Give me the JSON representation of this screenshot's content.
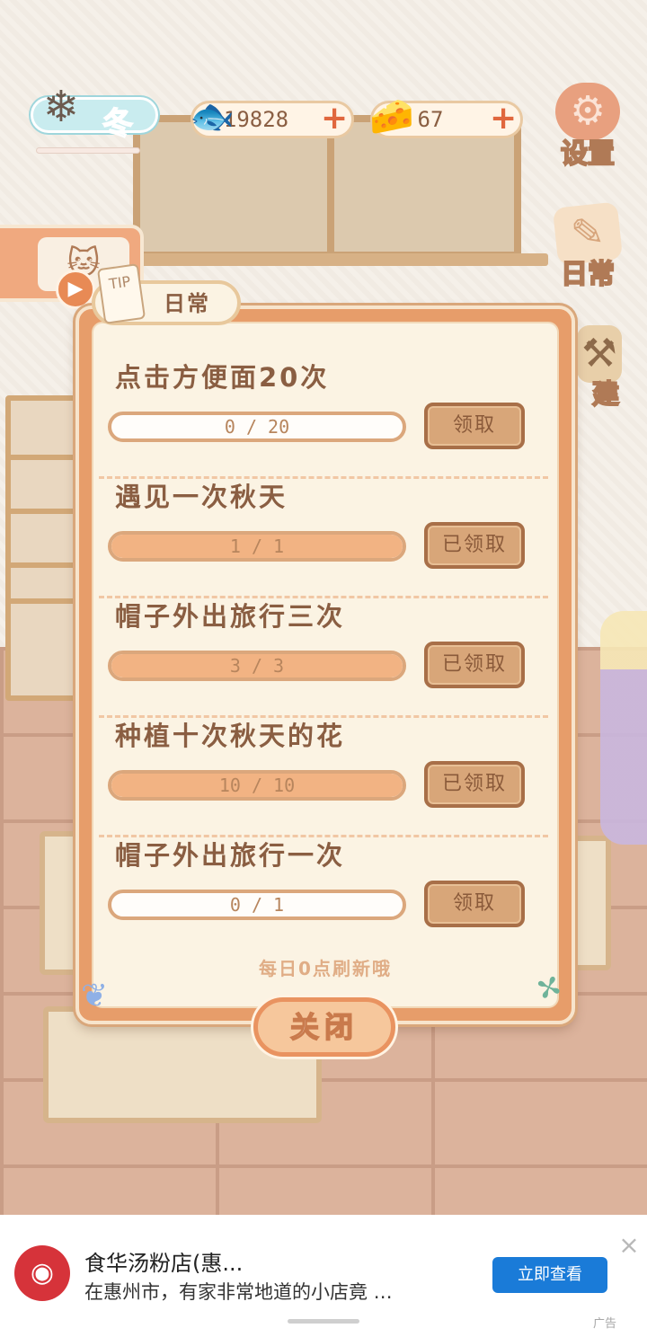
{
  "hud": {
    "season_label": "冬",
    "season_progress": 0.0,
    "fish_count": "19828",
    "cheese_count": "67",
    "plus": "+",
    "settings_label": "设置",
    "daily_label": "日常",
    "build_label": "建"
  },
  "dialog": {
    "title": "日常",
    "note_label": "TIP",
    "tasks": [
      {
        "name": "点击方便面20次",
        "progress_text": "0 / 20",
        "progress": 0.0,
        "button": "领取"
      },
      {
        "name": "遇见一次秋天",
        "progress_text": "1 / 1",
        "progress": 1.0,
        "button": "已领取"
      },
      {
        "name": "帽子外出旅行三次",
        "progress_text": "3 / 3",
        "progress": 1.0,
        "button": "已领取"
      },
      {
        "name": "种植十次秋天的花",
        "progress_text": "10 / 10",
        "progress": 1.0,
        "button": "已领取"
      },
      {
        "name": "帽子外出旅行一次",
        "progress_text": "0 / 1",
        "progress": 0.0,
        "button": "领取"
      }
    ],
    "refresh_note": "每日0点刷新哦",
    "close_label": "关闭"
  },
  "ad": {
    "title": "食华汤粉店(惠...",
    "description": "在惠州市，有家非常地道的小店竟 …",
    "cta": "立即查看",
    "close": "×",
    "tag": "广告"
  },
  "icons": {
    "fish": "fish-bone-icon",
    "cheese": "cheese-icon",
    "settings": "gear-icon",
    "daily": "note-icon",
    "build": "hammer-icon",
    "play": "play-icon"
  },
  "colors": {
    "accent": "#e79d6a",
    "panel": "#fbf3e3",
    "text": "#8a5e42",
    "ad_cta": "#1a7bd8"
  }
}
